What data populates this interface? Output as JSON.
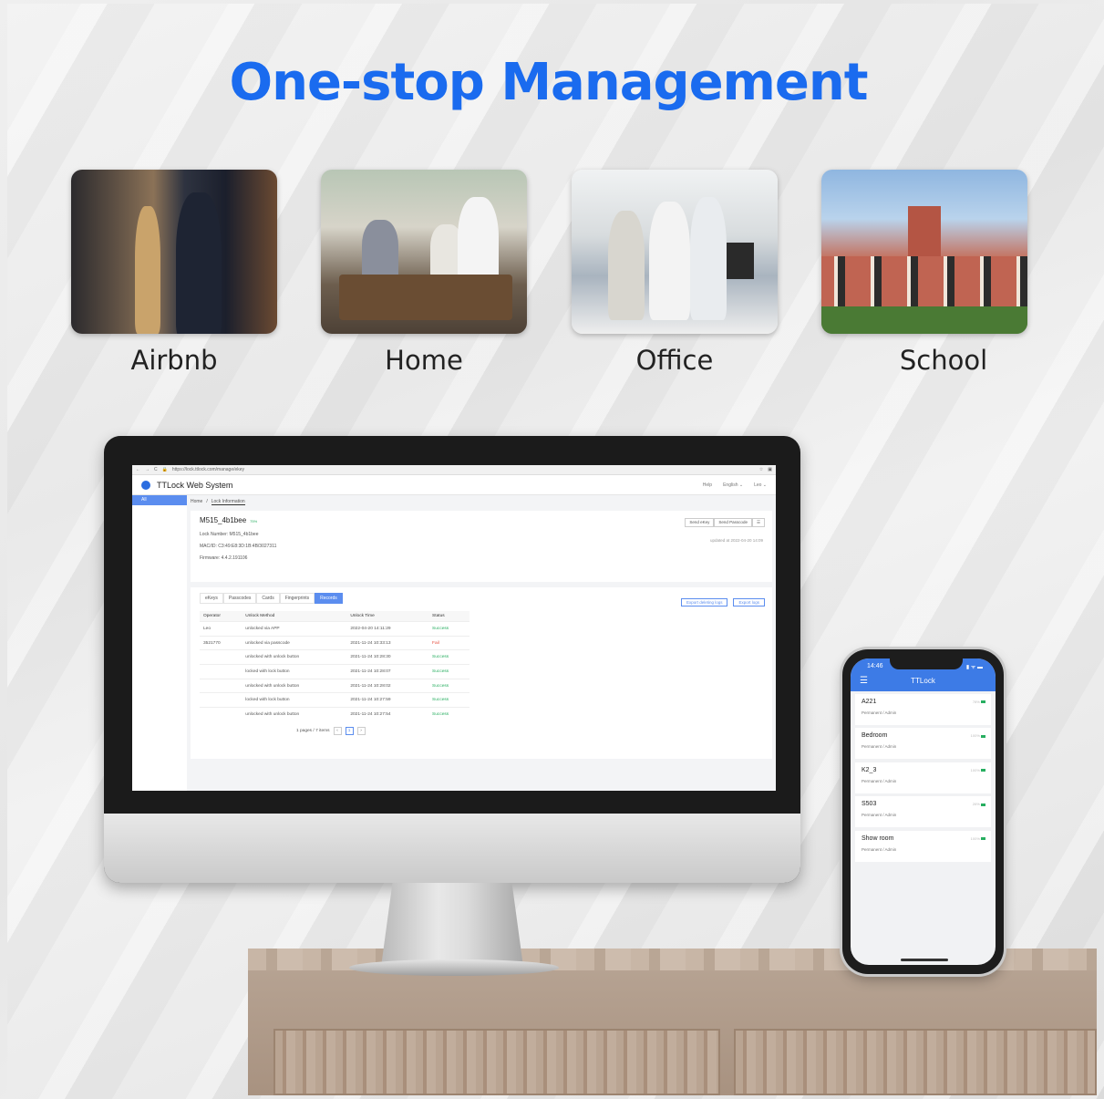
{
  "headline": "One-stop Management",
  "scenarios": [
    {
      "label": "Airbnb",
      "icon": "airbnb-photo"
    },
    {
      "label": "Home",
      "icon": "home-photo"
    },
    {
      "label": "Office",
      "icon": "office-photo"
    },
    {
      "label": "School",
      "icon": "school-photo"
    }
  ],
  "web": {
    "url": "https://lock.ttlock.com/manage/ekey",
    "app_title": "TTLock Web System",
    "nav": {
      "help": "Help",
      "language": "English ⌄",
      "user": "Leo ⌄"
    },
    "sidebar": {
      "all": "All"
    },
    "breadcrumb": {
      "home": "Home",
      "sep": "/",
      "current": "Lock Information"
    },
    "lock": {
      "name": "M515_4b1bee",
      "battery": "75%",
      "lock_number_label": "Lock Number:",
      "lock_number": "M515_4b1bee",
      "mac_label": "MAC/ID:",
      "mac": "C3:49:E8:3D:1B:4B/3027311",
      "firmware_label": "Firmware:",
      "firmware": "4.4.2.191106",
      "send_ekey": "Send eKey",
      "send_passcode": "Send Passcode",
      "more": "☰",
      "updated": "updated at 2022-04-20 14:09"
    },
    "tabs": [
      "eKeys",
      "Passcodes",
      "Cards",
      "Fingerprints",
      "Records"
    ],
    "export_deleting": "Export deleting logs",
    "export_logs": "Export logs",
    "table": {
      "headers": [
        "Operator",
        "Unlock Method",
        "Unlock Time",
        "Status"
      ],
      "rows": [
        [
          "Leo",
          "unlocked via APP",
          "2022-04-20 14:11:29",
          "Success"
        ],
        [
          "3521770",
          "unlocked via passcode",
          "2021-11-24 10:33:13",
          "Fail"
        ],
        [
          "",
          "unlocked with unlock button",
          "2021-11-24 10:28:30",
          "Success"
        ],
        [
          "",
          "locked with lock button",
          "2021-11-24 10:28:07",
          "Success"
        ],
        [
          "",
          "unlocked with unlock button",
          "2021-11-24 10:28:02",
          "Success"
        ],
        [
          "",
          "locked with lock button",
          "2021-11-24 10:27:59",
          "Success"
        ],
        [
          "",
          "unlocked with unlock button",
          "2021-11-24 10:27:54",
          "Success"
        ]
      ]
    },
    "pager": {
      "summary": "1 pages / 7 items",
      "prev": "‹",
      "page": "1",
      "next": "›"
    }
  },
  "phone": {
    "time": "14:46",
    "status": "▮ ᯤ ▬",
    "menu": "☰",
    "title": "TTLock",
    "locks": [
      {
        "name": "A221",
        "sub": "Permanent / Admin",
        "battery": "78%"
      },
      {
        "name": "Bedroom",
        "sub": "Permanent / Admin",
        "battery": "100%"
      },
      {
        "name": "K2_3",
        "sub": "Permanent / Admin",
        "battery": "100%"
      },
      {
        "name": "S503",
        "sub": "Permanent / Admin",
        "battery": "26%"
      },
      {
        "name": "Show room",
        "sub": "Permanent / Admin",
        "battery": "100%"
      }
    ]
  }
}
